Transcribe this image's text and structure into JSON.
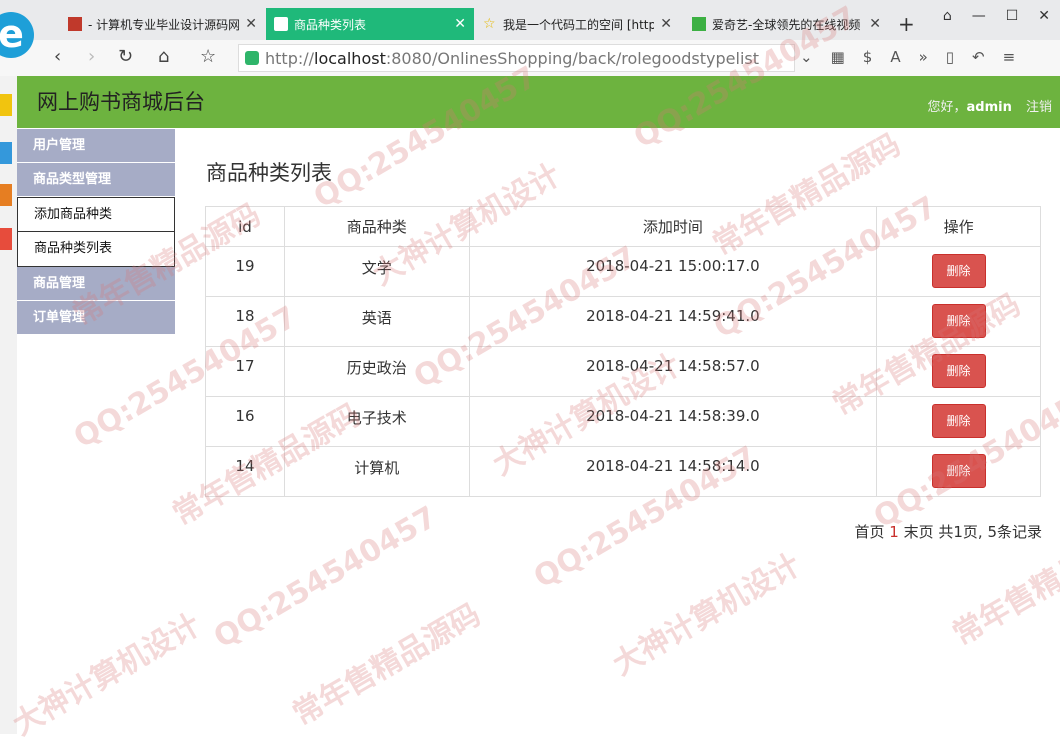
{
  "browser": {
    "tabs": [
      {
        "title": "- 计算机专业毕业设计源码网",
        "active": false
      },
      {
        "title": "商品种类列表",
        "active": true
      },
      {
        "title": "我是一个代码工的空间 [http",
        "active": false
      },
      {
        "title": "爱奇艺-全球领先的在线视频",
        "active": false
      }
    ],
    "new_tab": "+",
    "url_scheme": "http://",
    "url_host": "localhost",
    "url_rest": ":8080/OnlinesShopping/back/rolegoodstypelist"
  },
  "header": {
    "title": "网上购书商城后台",
    "greeting": "您好，",
    "username": "admin",
    "logout": "注销"
  },
  "sidebar": {
    "items": [
      {
        "label": "用户管理",
        "type": "group"
      },
      {
        "label": "商品类型管理",
        "type": "group"
      },
      {
        "label": "添加商品种类",
        "type": "sub"
      },
      {
        "label": "商品种类列表",
        "type": "sub"
      },
      {
        "label": "商品管理",
        "type": "group"
      },
      {
        "label": "订单管理",
        "type": "group"
      }
    ]
  },
  "main": {
    "title": "商品种类列表",
    "columns": [
      "id",
      "商品种类",
      "添加时间",
      "操作"
    ],
    "rows": [
      {
        "id": "19",
        "name": "文学",
        "time": "2018-04-21 15:00:17.0",
        "action": "删除"
      },
      {
        "id": "18",
        "name": "英语",
        "time": "2018-04-21 14:59:41.0",
        "action": "删除"
      },
      {
        "id": "17",
        "name": "历史政治",
        "time": "2018-04-21 14:58:57.0",
        "action": "删除"
      },
      {
        "id": "16",
        "name": "电子技术",
        "time": "2018-04-21 14:58:39.0",
        "action": "删除"
      },
      {
        "id": "14",
        "name": "计算机",
        "time": "2018-04-21 14:58:14.0",
        "action": "删除"
      }
    ],
    "pager": {
      "first": "首页",
      "current": "1",
      "last": "末页",
      "summary": "共1页, 5条记录"
    }
  },
  "watermarks": [
    "QQ:254540457",
    "常年售精品源码",
    "大神计算机设计"
  ],
  "colors": {
    "header_green": "#6db33f",
    "sidebar_group": "#a6acc6",
    "delete_red": "#d9534f",
    "active_tab": "#1fb97a"
  }
}
